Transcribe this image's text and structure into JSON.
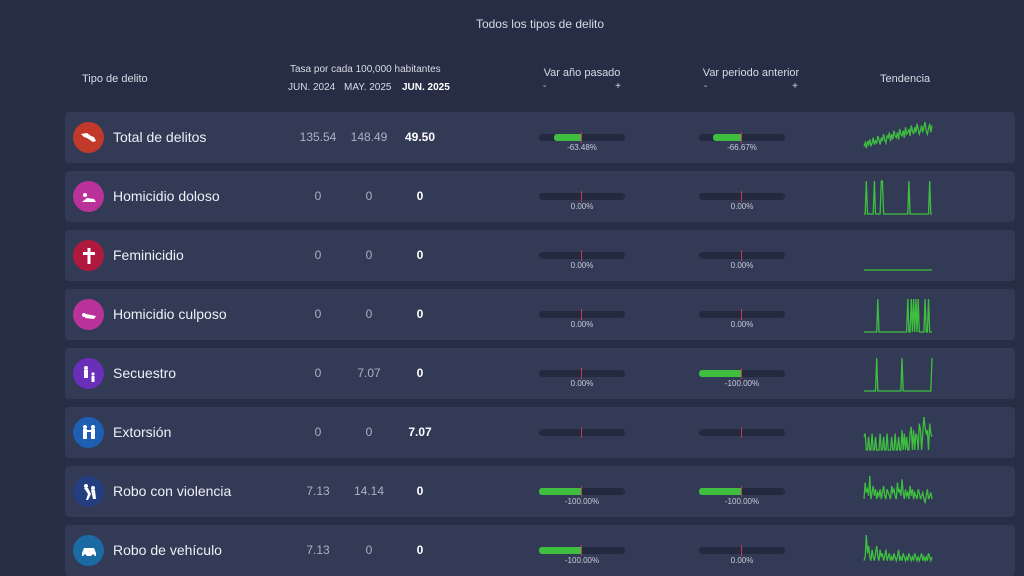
{
  "header": {
    "subtitle": "Todos los tipos de delito"
  },
  "columns": {
    "type": "Tipo de delito",
    "rate": "Tasa por cada 100,000 habitantes",
    "jun2024": "JUN. 2024",
    "may2025": "MAY. 2025",
    "jun2025": "JUN. 2025",
    "var_year": "Var año pasado",
    "var_period": "Var periodo anterior",
    "minus": "-",
    "plus": "+",
    "trend": "Tendencia"
  },
  "colors": {
    "positive_bar": "#3fbf3f",
    "row_bg": "#323a56",
    "page_bg": "#262d44"
  },
  "rows": [
    {
      "name": "Total de delitos",
      "icon": "mexico-map-icon",
      "icon_color": "#c0392b",
      "jun2024": "135.54",
      "may2025": "148.49",
      "jun2025": "49.50",
      "var_year": -63.48,
      "var_year_label": "-63.48%",
      "var_period": -66.67,
      "var_period_label": "-66.67%",
      "trend": [
        5,
        7,
        4,
        8,
        6,
        9,
        5,
        7,
        10,
        6,
        8,
        7,
        11,
        9,
        6,
        10,
        8,
        12,
        9,
        7,
        11,
        10,
        13,
        8,
        12,
        9,
        14,
        11,
        10,
        13,
        9,
        15,
        12,
        11,
        14,
        10,
        16,
        12,
        13,
        15,
        11,
        17,
        14,
        12,
        16,
        13,
        18,
        15,
        12,
        14,
        17,
        13,
        16,
        19,
        14,
        12,
        15,
        18,
        13,
        17
      ]
    },
    {
      "name": "Homicidio doloso",
      "icon": "homicide-icon",
      "icon_color": "#b8329a",
      "jun2024": "0",
      "may2025": "0",
      "jun2025": "0",
      "var_year": 0,
      "var_year_label": "0.00%",
      "var_period": 0,
      "var_period_label": "0.00%",
      "trend": [
        0,
        0,
        1,
        0,
        0,
        0,
        0,
        0,
        0,
        1,
        0,
        0,
        0,
        0,
        0,
        1,
        1,
        0,
        0,
        0,
        0,
        0,
        0,
        0,
        0,
        0,
        0,
        0,
        0,
        0,
        0,
        0,
        0,
        0,
        0,
        0,
        0,
        0,
        0,
        1,
        0,
        0,
        0,
        0,
        0,
        0,
        0,
        0,
        0,
        0,
        0,
        0,
        0,
        0,
        0,
        0,
        0,
        1,
        0,
        0
      ]
    },
    {
      "name": "Feminicidio",
      "icon": "cross-icon",
      "icon_color": "#b0193e",
      "jun2024": "0",
      "may2025": "0",
      "jun2025": "0",
      "var_year": 0,
      "var_year_label": "0.00%",
      "var_period": 0,
      "var_period_label": "0.00%",
      "trend": [
        0,
        0,
        0,
        0,
        0,
        0,
        0,
        0,
        0,
        0,
        0,
        0,
        0,
        0,
        0,
        0,
        0,
        0,
        0,
        0,
        0,
        0,
        0,
        0,
        0,
        0,
        0,
        0,
        0,
        0,
        0,
        0,
        0,
        0,
        0,
        0,
        0,
        0,
        0,
        0,
        0,
        0,
        0,
        0,
        0,
        0,
        0,
        0,
        0,
        0,
        0,
        0,
        0,
        0,
        0,
        0,
        0,
        0,
        0,
        0
      ]
    },
    {
      "name": "Homicidio culposo",
      "icon": "accident-icon",
      "icon_color": "#b8329a",
      "jun2024": "0",
      "may2025": "0",
      "jun2025": "0",
      "var_year": 0,
      "var_year_label": "0.00%",
      "var_period": 0,
      "var_period_label": "0.00%",
      "trend": [
        0,
        0,
        0,
        0,
        0,
        0,
        0,
        0,
        0,
        0,
        0,
        0,
        1,
        0,
        0,
        0,
        0,
        0,
        0,
        0,
        0,
        0,
        0,
        0,
        0,
        0,
        0,
        0,
        0,
        0,
        0,
        0,
        0,
        0,
        0,
        0,
        0,
        0,
        1,
        0,
        0,
        1,
        0,
        1,
        0,
        1,
        0,
        1,
        0,
        0,
        0,
        0,
        0,
        1,
        0,
        0,
        1,
        0,
        0,
        0
      ]
    },
    {
      "name": "Secuestro",
      "icon": "kidnapping-icon",
      "icon_color": "#6a2fb8",
      "jun2024": "0",
      "may2025": "7.07",
      "jun2025": "0",
      "var_year": 0,
      "var_year_label": "0.00%",
      "var_period": -100,
      "var_period_label": "-100.00%",
      "trend": [
        0,
        0,
        0,
        0,
        0,
        0,
        0,
        0,
        0,
        0,
        0,
        1,
        0,
        0,
        0,
        0,
        0,
        0,
        0,
        0,
        0,
        0,
        0,
        0,
        0,
        0,
        0,
        0,
        0,
        0,
        0,
        0,
        0,
        1,
        0,
        0,
        0,
        0,
        0,
        0,
        0,
        0,
        0,
        0,
        0,
        0,
        0,
        0,
        0,
        0,
        0,
        0,
        0,
        0,
        0,
        0,
        0,
        0,
        0,
        1
      ]
    },
    {
      "name": "Extorsión",
      "icon": "extortion-icon",
      "icon_color": "#1e5fb3",
      "jun2024": "0",
      "may2025": "0",
      "jun2025": "7.07",
      "var_year": 0,
      "var_year_label": "",
      "var_period": 0,
      "var_period_label": "",
      "trend": [
        0.4,
        0.5,
        0,
        0,
        0.4,
        0,
        0,
        0.5,
        0,
        0,
        0.4,
        0,
        0,
        0,
        0.5,
        0,
        0,
        0.4,
        0,
        0,
        0.5,
        0,
        0,
        0,
        0.4,
        0,
        0,
        0.5,
        0,
        0,
        0.4,
        0,
        0,
        0.6,
        0,
        0.5,
        0,
        0.4,
        0,
        0,
        0.5,
        0.7,
        0,
        0.6,
        0,
        0.5,
        0.4,
        0,
        0.8,
        0.6,
        0,
        0.5,
        1,
        0.7,
        0.5,
        0.6,
        0,
        0.8,
        0.5,
        0.4
      ]
    },
    {
      "name": "Robo con violencia",
      "icon": "robbery-icon",
      "icon_color": "#243e80",
      "jun2024": "7.13",
      "may2025": "14.14",
      "jun2025": "0",
      "var_year": -100,
      "var_year_label": "-100.00%",
      "var_period": -100,
      "var_period_label": "-100.00%",
      "trend": [
        0.3,
        0.8,
        0.5,
        0.6,
        0.4,
        1,
        0.3,
        0.5,
        0.7,
        0.4,
        0.6,
        0.3,
        0.5,
        0.4,
        0.6,
        0.3,
        0.5,
        0.7,
        0.4,
        0.3,
        0.6,
        0.5,
        0.4,
        0.3,
        0.7,
        0.5,
        0.6,
        0.4,
        0.3,
        0.8,
        0.5,
        0.6,
        0.4,
        0.9,
        0.5,
        0.3,
        0.6,
        0.4,
        0.5,
        0.3,
        0.7,
        0.4,
        0.6,
        0.3,
        0.5,
        0.4,
        0.3,
        0.6,
        0.5,
        0.3,
        0.4,
        0.5,
        0.3,
        0.2,
        0.4,
        0.6,
        0.3,
        0.4,
        0.5,
        0.3
      ]
    },
    {
      "name": "Robo de vehículo",
      "icon": "car-icon",
      "icon_color": "#1a6aa3",
      "jun2024": "7.13",
      "may2025": "0",
      "jun2025": "0",
      "var_year": -100,
      "var_year_label": "-100.00%",
      "var_period": 0,
      "var_period_label": "0.00%",
      "trend": [
        0.2,
        0.3,
        0.9,
        0.4,
        0.6,
        0.3,
        0.2,
        0.5,
        0.3,
        0.2,
        0.4,
        0.6,
        0.3,
        0.2,
        0.5,
        0.3,
        0.4,
        0.2,
        0.3,
        0.5,
        0.2,
        0.3,
        0.4,
        0.2,
        0.3,
        0.2,
        0.4,
        0.3,
        0.2,
        0.3,
        0.5,
        0.2,
        0.3,
        0.2,
        0.4,
        0.3,
        0.2,
        0.3,
        0.2,
        0.4,
        0.3,
        0.2,
        0.3,
        0.2,
        0.4,
        0.3,
        0.2,
        0.3,
        0.2,
        0.3,
        0.4,
        0.2,
        0.3,
        0.2,
        0.3,
        0.2,
        0.4,
        0.3,
        0.2,
        0.3
      ]
    }
  ]
}
